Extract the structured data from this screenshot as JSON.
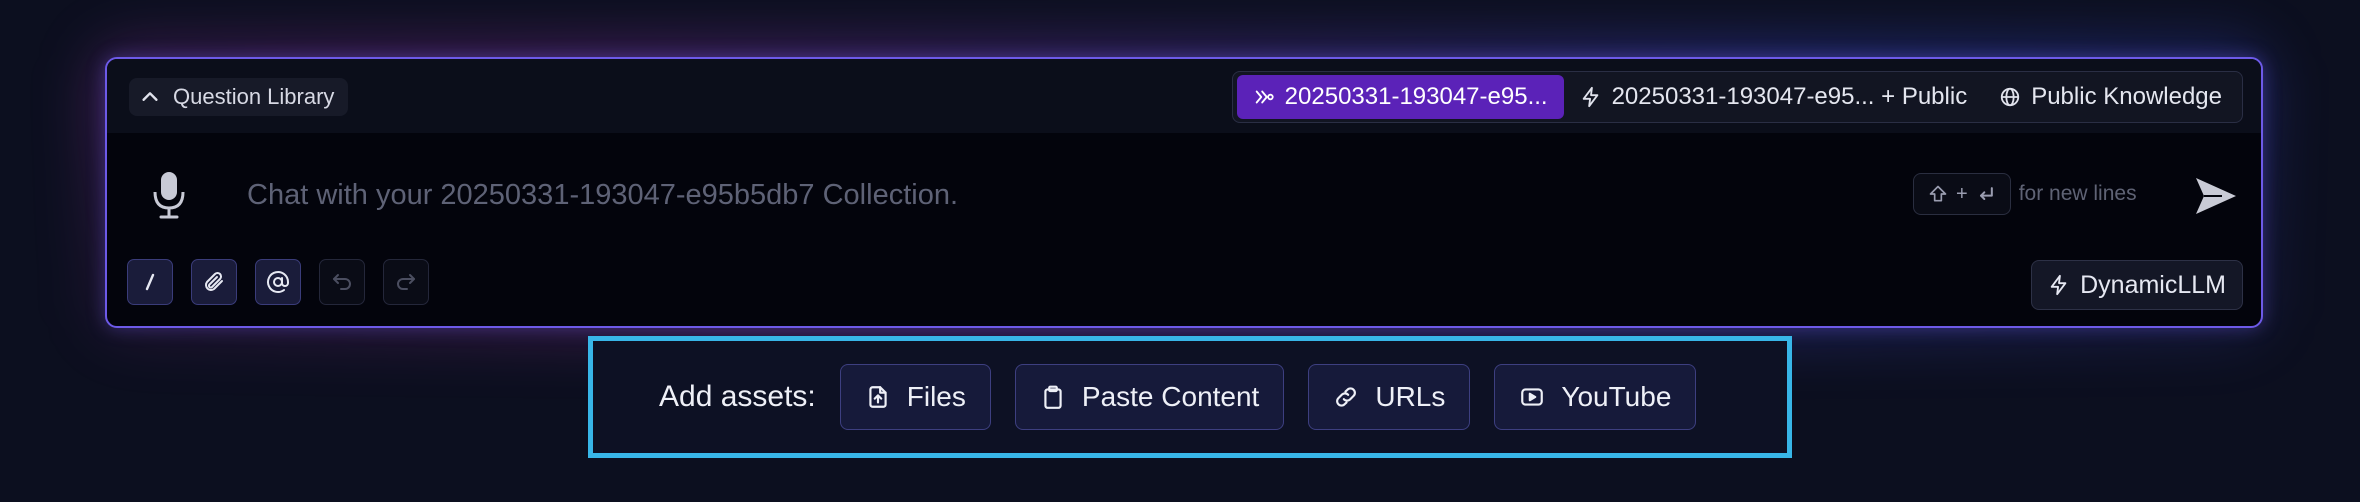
{
  "question_library": {
    "label": "Question Library",
    "icon": "chevron-up-icon"
  },
  "modes": [
    {
      "label": "20250331-193047-e95...",
      "icon": "double-chevron-icon",
      "active": true
    },
    {
      "label": "20250331-193047-e95... + Public",
      "icon": "lightning-icon",
      "active": false
    },
    {
      "label": "Public Knowledge",
      "icon": "globe-icon",
      "active": false
    }
  ],
  "chat": {
    "value": "",
    "placeholder": "Chat with your 20250331-193047-e95b5db7 Collection.",
    "kbd_label": "+",
    "hint": "for new lines"
  },
  "tools": [
    {
      "name": "slash-command-icon",
      "enabled": true
    },
    {
      "name": "paperclip-icon",
      "enabled": true
    },
    {
      "name": "at-mention-icon",
      "enabled": true
    },
    {
      "name": "undo-icon",
      "enabled": false
    },
    {
      "name": "redo-icon",
      "enabled": false
    }
  ],
  "model": {
    "label": "DynamicLLM",
    "icon": "lightning-icon"
  },
  "assets": {
    "label": "Add assets:",
    "buttons": [
      {
        "label": "Files",
        "icon": "file-upload-icon"
      },
      {
        "label": "Paste Content",
        "icon": "clipboard-icon"
      },
      {
        "label": "URLs",
        "icon": "link-icon"
      },
      {
        "label": "YouTube",
        "icon": "youtube-icon"
      }
    ]
  },
  "colors": {
    "accent": "#5b22b8",
    "panel_border": "#6d5ae8",
    "assets_border": "#38b6e8",
    "background": "#0c0f1f"
  }
}
